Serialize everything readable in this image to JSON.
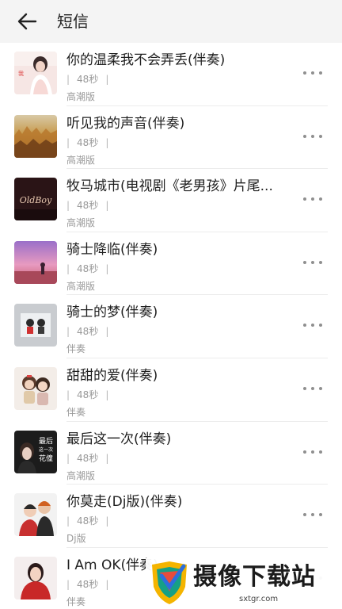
{
  "header": {
    "back_icon": "arrow-left-icon",
    "title": "短信"
  },
  "songs": [
    {
      "title": "你的温柔我不会弄丢(伴奏)",
      "duration": "48秒",
      "tag": "高潮版",
      "cover": "portrait-woman-pink"
    },
    {
      "title": "听见我的声音(伴奏)",
      "duration": "48秒",
      "tag": "高潮版",
      "cover": "golden-field"
    },
    {
      "title": "牧马城市(电视剧《老男孩》片尾...",
      "duration": "48秒",
      "tag": "高潮版",
      "cover": "dark-red-logo"
    },
    {
      "title": "骑士降临(伴奏)",
      "duration": "48秒",
      "tag": "高潮版",
      "cover": "pink-sky"
    },
    {
      "title": "骑士的梦(伴奏)",
      "duration": "48秒",
      "tag": "伴奏",
      "cover": "cartoon-figures"
    },
    {
      "title": "甜甜的爱(伴奏)",
      "duration": "48秒",
      "tag": "伴奏",
      "cover": "cartoon-couple"
    },
    {
      "title": "最后这一次(伴奏)",
      "duration": "48秒",
      "tag": "高潮版",
      "cover": "portrait-dark-text"
    },
    {
      "title": "你莫走(Dj版)(伴奏)",
      "duration": "48秒",
      "tag": "Dj版",
      "cover": "couple-photo"
    },
    {
      "title": "I Am OK(伴奏)",
      "duration": "48秒",
      "tag": "伴奏",
      "cover": "portrait-red-dress"
    }
  ],
  "cover_texts": {
    "c2": "OldBoy",
    "c6_line1": "最后",
    "c6_line2": "这一次",
    "c6_line3": "花僮"
  },
  "more_icon": "more-dots-icon",
  "watermark": {
    "text": "摄像下载站",
    "url": "sxtgr.com"
  },
  "colors": {
    "background": "#f4f4f4",
    "list_background": "#ffffff",
    "title_text": "#1f1f1f",
    "meta_text": "#9a9a9a"
  }
}
